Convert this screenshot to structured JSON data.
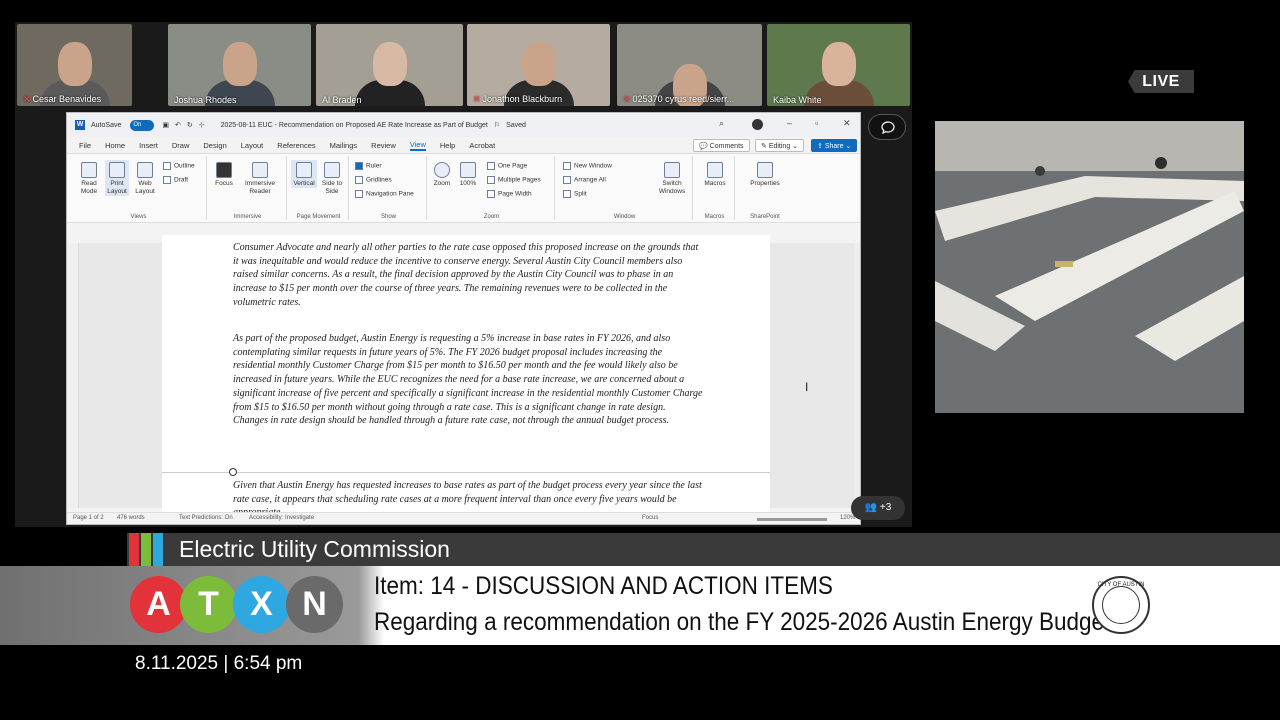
{
  "participants": [
    {
      "name": "Cesar Benavides",
      "muted": true
    },
    {
      "name": "Joshua Rhodes",
      "muted": false
    },
    {
      "name": "Al Braden",
      "muted": false
    },
    {
      "name": "Jonathon Blackburn",
      "muted": true
    },
    {
      "name": "025370 cyrus reed/sierr...",
      "muted": true
    },
    {
      "name": "Kaiba White",
      "muted": false
    }
  ],
  "live_label": "LIVE",
  "extra_participants": "+3",
  "word": {
    "autosave_label": "AutoSave",
    "autosave_state": "On",
    "doc_title": "2025-08-11 EUC - Recommendation on Proposed AE Rate Increase as Part of Budget",
    "saved_label": "Saved",
    "menus": [
      "File",
      "Home",
      "Insert",
      "Draw",
      "Design",
      "Layout",
      "References",
      "Mailings",
      "Review",
      "View",
      "Help",
      "Acrobat"
    ],
    "active_menu": "View",
    "comments_label": "Comments",
    "editing_label": "Editing",
    "share_label": "Share",
    "ribbon": {
      "views": {
        "label": "Views",
        "read_mode": "Read Mode",
        "print_layout": "Print Layout",
        "web_layout": "Web Layout",
        "outline": "Outline",
        "draft": "Draft"
      },
      "immersive": {
        "label": "Immersive",
        "focus": "Focus",
        "immersive_reader": "Immersive Reader"
      },
      "page_movement": {
        "label": "Page Movement",
        "vertical": "Vertical",
        "side_to_side": "Side to Side"
      },
      "show": {
        "label": "Show",
        "ruler": "Ruler",
        "gridlines": "Gridlines",
        "navigation_pane": "Navigation Pane"
      },
      "zoom": {
        "label": "Zoom",
        "zoom": "Zoom",
        "pct": "100%",
        "one_page": "One Page",
        "multiple_pages": "Multiple Pages",
        "page_width": "Page Width"
      },
      "window": {
        "label": "Window",
        "new_window": "New Window",
        "arrange_all": "Arrange All",
        "split": "Split",
        "switch_windows": "Switch Windows"
      },
      "macros": {
        "label": "Macros",
        "macros": "Macros"
      },
      "sharepoint": {
        "label": "SharePoint",
        "properties": "Properties"
      }
    },
    "paragraphs": [
      "Consumer Advocate and nearly all other parties to the rate case opposed this proposed increase on the grounds that it was inequitable and would reduce the incentive to conserve energy. Several Austin City Council members also raised similar concerns. As a result, the final decision approved by the Austin City Council was to phase in an increase to $15 per month over the course of three years. The remaining revenues were to be collected in the volumetric rates.",
      "As part of the proposed budget, Austin Energy is requesting a 5% increase in base rates in FY 2026, and also contemplating similar requests in future years of 5%. The FY 2026 budget proposal includes increasing the residential monthly Customer Charge from $15 per month to $16.50 per month and the fee would likely also be increased in future years. While the EUC recognizes the need for a base rate increase, we are concerned about a significant increase of five percent and specifically a significant increase in the residential monthly Customer Charge from $15 to $16.50 per month without going through a rate case. This is a significant change in rate design. Changes in rate design should be handled through a future rate case, not through the annual budget process.",
      "Given that Austin Energy has requested increases to base rates as part of the budget process every year since the last rate case, it appears that scheduling rate cases at a more frequent interval than once every five years would be appropriate."
    ],
    "status": {
      "page": "Page 1 of 2",
      "words": "476 words",
      "text_predictions": "Text Predictions: On",
      "accessibility": "Accessibility: Investigate",
      "focus": "Focus",
      "zoom": "120%"
    }
  },
  "lower_third": {
    "commission": "Electric Utility Commission",
    "item": "Item: 14 - DISCUSSION AND ACTION ITEMS",
    "regarding": "Regarding a recommendation on the FY 2025-2026 Austin Energy Budget",
    "datetime": "8.11.2025 | 6:54 pm",
    "logo_letters": [
      "A",
      "T",
      "X",
      "N"
    ],
    "logo_colors": [
      "#e3333a",
      "#7dbb3a",
      "#2fa7e0",
      "#6a6a6a"
    ],
    "stripe_colors": [
      "#e3333a",
      "#7dbb3a",
      "#2fa7e0"
    ],
    "seal_text": "CITY OF AUSTIN"
  }
}
